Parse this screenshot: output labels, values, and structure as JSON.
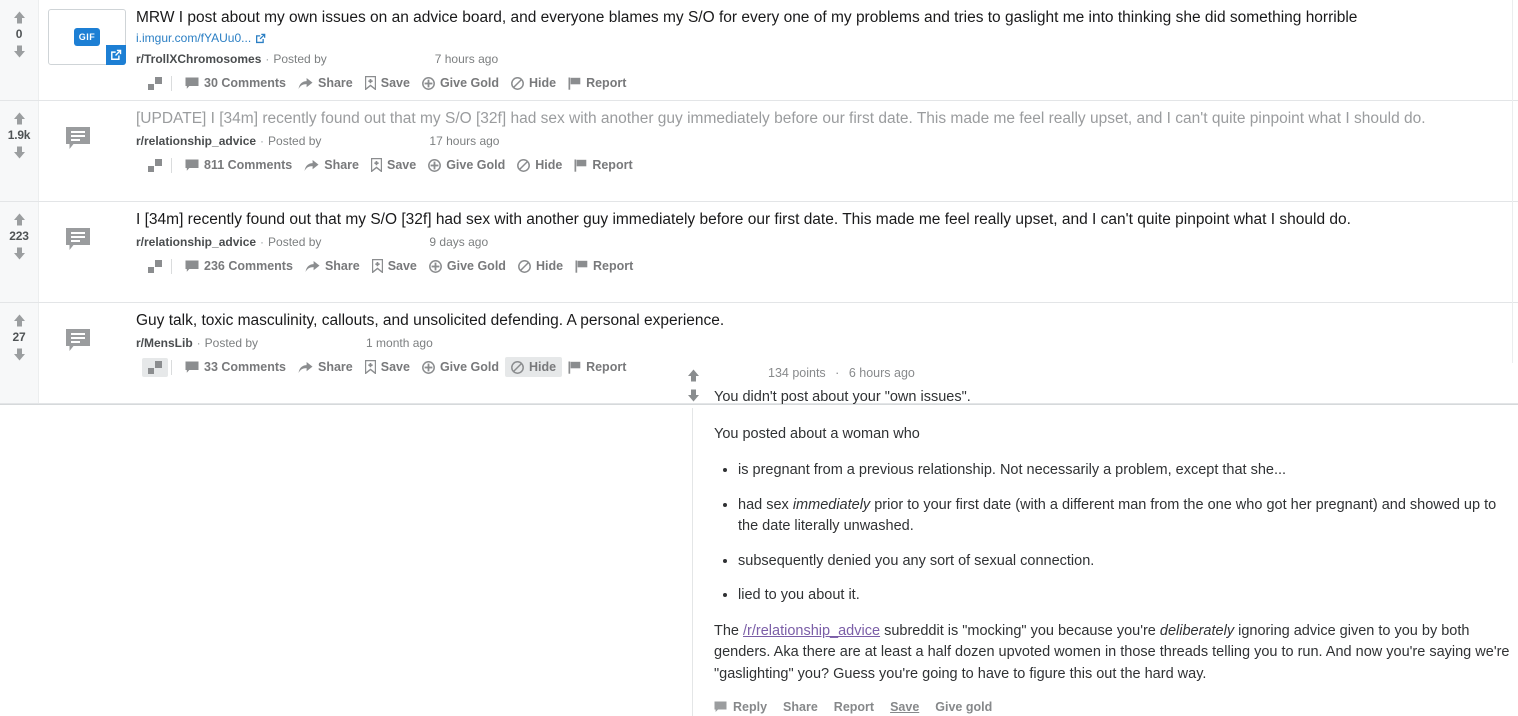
{
  "colors": {
    "accent_blue": "#2b7fc4",
    "badge_blue": "#1d7fd4",
    "link_visited": "#7b5ea7",
    "title": "#1a1a1b",
    "title_visited": "#9a9c9e",
    "meta": "#7c7f80",
    "action": "#78797b"
  },
  "action_labels": {
    "share": "Share",
    "save": "Save",
    "give_gold": "Give Gold",
    "hide": "Hide",
    "report": "Report"
  },
  "meta_labels": {
    "posted_by": "Posted by",
    "separator": "·"
  },
  "posts": [
    {
      "score": "0",
      "title": "MRW I post about my own issues on an advice board, and everyone blames my S/O for every one of my problems and tries to gaslight me into thinking she did something horrible",
      "visited": false,
      "thumb_type": "image",
      "thumb_badge": "GIF",
      "domain": "i.imgur.com/fYAUu0...",
      "subreddit": "r/TrollXChromosomes",
      "age": "7 hours ago",
      "comments": "30 Comments",
      "hide_highlighted": false,
      "expand_highlighted": false
    },
    {
      "score": "1.9k",
      "title": "[UPDATE] I [34m] recently found out that my S/O [32f] had sex with another guy immediately before our first date. This made me feel really upset, and I can't quite pinpoint what I should do.",
      "visited": true,
      "thumb_type": "self",
      "thumb_badge": "",
      "domain": "",
      "subreddit": "r/relationship_advice",
      "age": "17 hours ago",
      "comments": "811 Comments",
      "hide_highlighted": false,
      "expand_highlighted": false
    },
    {
      "score": "223",
      "title": "I [34m] recently found out that my S/O [32f] had sex with another guy immediately before our first date. This made me feel really upset, and I can't quite pinpoint what I should do.",
      "visited": false,
      "thumb_type": "self",
      "thumb_badge": "",
      "domain": "",
      "subreddit": "r/relationship_advice",
      "age": "9 days ago",
      "comments": "236 Comments",
      "hide_highlighted": false,
      "expand_highlighted": false
    },
    {
      "score": "27",
      "title": "Guy talk, toxic masculinity, callouts, and unsolicited defending. A personal experience.",
      "visited": false,
      "thumb_type": "self",
      "thumb_badge": "",
      "domain": "",
      "subreddit": "r/MensLib",
      "age": "1 month ago",
      "comments": "33 Comments",
      "hide_highlighted": true,
      "expand_highlighted": true
    }
  ],
  "comment": {
    "points": "134 points",
    "separator": "·",
    "age": "6 hours ago",
    "line1": "You didn't post about your \"own issues\".",
    "line2": "You posted about a woman who",
    "bullets": [
      {
        "pre": "is pregnant from a previous relationship. Not necessarily a problem, except that she...",
        "em": "",
        "post": ""
      },
      {
        "pre": "had sex ",
        "em": "immediately",
        "post": " prior to your first date (with a different man from the one who got her pregnant) and showed up to the date literally unwashed."
      },
      {
        "pre": "subsequently denied you any sort of sexual connection.",
        "em": "",
        "post": ""
      },
      {
        "pre": "lied to you about it.",
        "em": "",
        "post": ""
      }
    ],
    "closing": {
      "pre": "The ",
      "link": "/r/relationship_advice",
      "mid": " subreddit is \"mocking\" you because you're ",
      "em": "deliberately",
      "post": " ignoring advice given to you by both genders. Aka there are at least a half dozen upvoted women in those threads telling you to run. And now you're saying we're \"gaslighting\" you? Guess you're going to have to figure this out the hard way."
    },
    "actions": {
      "reply": "Reply",
      "share": "Share",
      "report": "Report",
      "save": "Save",
      "give_gold": "Give gold"
    }
  }
}
